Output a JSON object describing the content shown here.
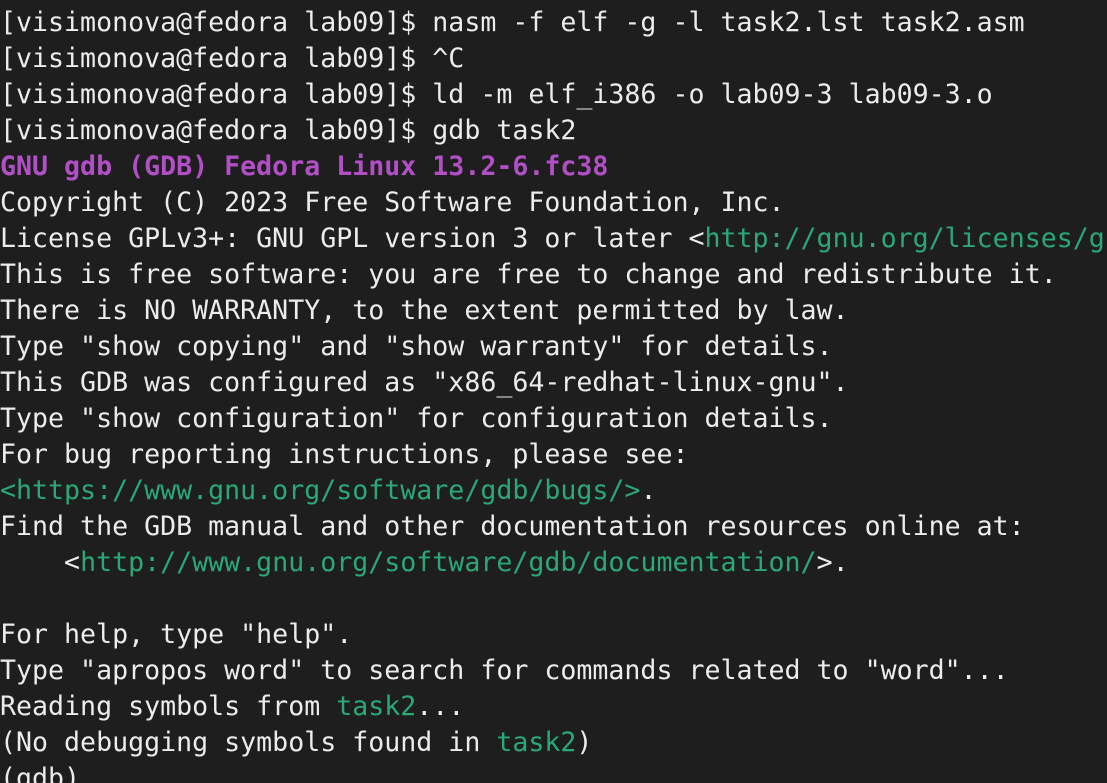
{
  "terminal": {
    "lines": [
      [
        {
          "t": "[visimonova@fedora lab09]$ nasm -f elf -g -l task2.lst task2.asm",
          "s": "normal"
        }
      ],
      [
        {
          "t": "[visimonova@fedora lab09]$ ^C",
          "s": "normal"
        }
      ],
      [
        {
          "t": "[visimonova@fedora lab09]$ ld -m elf_i386 -o lab09-3 lab09-3.o",
          "s": "normal"
        }
      ],
      [
        {
          "t": "[visimonova@fedora lab09]$ gdb task2",
          "s": "normal"
        }
      ],
      [
        {
          "t": "GNU gdb (GDB) Fedora Linux 13.2-6.fc38",
          "s": "banner"
        }
      ],
      [
        {
          "t": "Copyright (C) 2023 Free Software Foundation, Inc.",
          "s": "normal"
        }
      ],
      [
        {
          "t": "License GPLv3+: GNU GPL version 3 or later <",
          "s": "normal"
        },
        {
          "t": "http://gnu.org/licenses/gpl.html",
          "s": "link"
        },
        {
          "t": ">",
          "s": "normal"
        }
      ],
      [
        {
          "t": "This is free software: you are free to change and redistribute it.",
          "s": "normal"
        }
      ],
      [
        {
          "t": "There is NO WARRANTY, to the extent permitted by law.",
          "s": "normal"
        }
      ],
      [
        {
          "t": "Type \"show copying\" and \"show warranty\" for details.",
          "s": "normal"
        }
      ],
      [
        {
          "t": "This GDB was configured as \"x86_64-redhat-linux-gnu\".",
          "s": "normal"
        }
      ],
      [
        {
          "t": "Type \"show configuration\" for configuration details.",
          "s": "normal"
        }
      ],
      [
        {
          "t": "For bug reporting instructions, please see:",
          "s": "normal"
        }
      ],
      [
        {
          "t": "<https://www.gnu.org/software/gdb/bugs/>",
          "s": "link"
        },
        {
          "t": ".",
          "s": "normal"
        }
      ],
      [
        {
          "t": "Find the GDB manual and other documentation resources online at:",
          "s": "normal"
        }
      ],
      [
        {
          "t": "    <",
          "s": "normal"
        },
        {
          "t": "http://www.gnu.org/software/gdb/documentation/",
          "s": "link"
        },
        {
          "t": ">.",
          "s": "normal"
        }
      ],
      [
        {
          "t": "",
          "s": "normal"
        }
      ],
      [
        {
          "t": "For help, type \"help\".",
          "s": "normal"
        }
      ],
      [
        {
          "t": "Type \"apropos word\" to search for commands related to \"word\"...",
          "s": "normal"
        }
      ],
      [
        {
          "t": "Reading symbols from ",
          "s": "normal"
        },
        {
          "t": "task2",
          "s": "link"
        },
        {
          "t": "...",
          "s": "normal"
        }
      ],
      [
        {
          "t": "(No debugging symbols found in ",
          "s": "normal"
        },
        {
          "t": "task2",
          "s": "link"
        },
        {
          "t": ")",
          "s": "normal"
        }
      ],
      [
        {
          "t": "(gdb) ",
          "s": "normal"
        }
      ]
    ]
  }
}
